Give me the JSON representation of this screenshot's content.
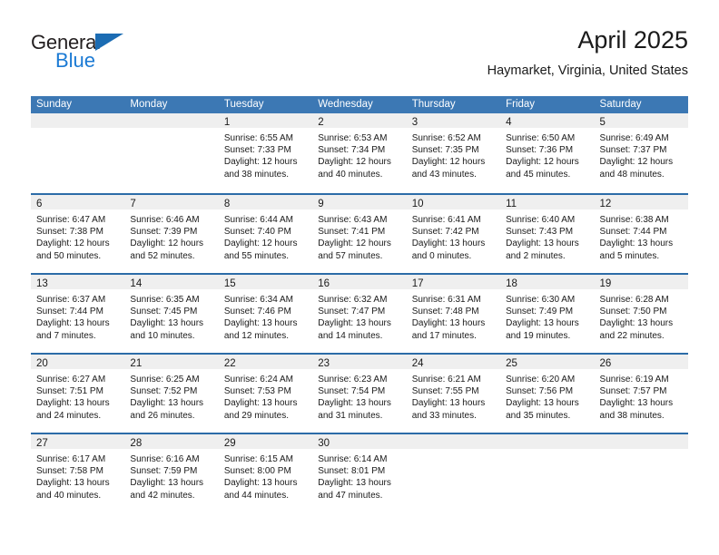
{
  "brand": {
    "name_part1": "General",
    "name_part2": "Blue",
    "accent_color": "#1b7ad4",
    "triangle_color": "#1b6cb3"
  },
  "header": {
    "title": "April 2025",
    "subtitle": "Haymarket, Virginia, United States"
  },
  "calendar": {
    "header_color": "#3c78b4",
    "row_divider_color": "#2c6ca8",
    "daynumber_band_color": "#efefef",
    "weekdays": [
      "Sunday",
      "Monday",
      "Tuesday",
      "Wednesday",
      "Thursday",
      "Friday",
      "Saturday"
    ],
    "weeks": [
      [
        {
          "day": "",
          "sunrise": "",
          "sunset": "",
          "daylight_line1": "",
          "daylight_line2": ""
        },
        {
          "day": "",
          "sunrise": "",
          "sunset": "",
          "daylight_line1": "",
          "daylight_line2": ""
        },
        {
          "day": "1",
          "sunrise": "Sunrise: 6:55 AM",
          "sunset": "Sunset: 7:33 PM",
          "daylight_line1": "Daylight: 12 hours",
          "daylight_line2": "and 38 minutes."
        },
        {
          "day": "2",
          "sunrise": "Sunrise: 6:53 AM",
          "sunset": "Sunset: 7:34 PM",
          "daylight_line1": "Daylight: 12 hours",
          "daylight_line2": "and 40 minutes."
        },
        {
          "day": "3",
          "sunrise": "Sunrise: 6:52 AM",
          "sunset": "Sunset: 7:35 PM",
          "daylight_line1": "Daylight: 12 hours",
          "daylight_line2": "and 43 minutes."
        },
        {
          "day": "4",
          "sunrise": "Sunrise: 6:50 AM",
          "sunset": "Sunset: 7:36 PM",
          "daylight_line1": "Daylight: 12 hours",
          "daylight_line2": "and 45 minutes."
        },
        {
          "day": "5",
          "sunrise": "Sunrise: 6:49 AM",
          "sunset": "Sunset: 7:37 PM",
          "daylight_line1": "Daylight: 12 hours",
          "daylight_line2": "and 48 minutes."
        }
      ],
      [
        {
          "day": "6",
          "sunrise": "Sunrise: 6:47 AM",
          "sunset": "Sunset: 7:38 PM",
          "daylight_line1": "Daylight: 12 hours",
          "daylight_line2": "and 50 minutes."
        },
        {
          "day": "7",
          "sunrise": "Sunrise: 6:46 AM",
          "sunset": "Sunset: 7:39 PM",
          "daylight_line1": "Daylight: 12 hours",
          "daylight_line2": "and 52 minutes."
        },
        {
          "day": "8",
          "sunrise": "Sunrise: 6:44 AM",
          "sunset": "Sunset: 7:40 PM",
          "daylight_line1": "Daylight: 12 hours",
          "daylight_line2": "and 55 minutes."
        },
        {
          "day": "9",
          "sunrise": "Sunrise: 6:43 AM",
          "sunset": "Sunset: 7:41 PM",
          "daylight_line1": "Daylight: 12 hours",
          "daylight_line2": "and 57 minutes."
        },
        {
          "day": "10",
          "sunrise": "Sunrise: 6:41 AM",
          "sunset": "Sunset: 7:42 PM",
          "daylight_line1": "Daylight: 13 hours",
          "daylight_line2": "and 0 minutes."
        },
        {
          "day": "11",
          "sunrise": "Sunrise: 6:40 AM",
          "sunset": "Sunset: 7:43 PM",
          "daylight_line1": "Daylight: 13 hours",
          "daylight_line2": "and 2 minutes."
        },
        {
          "day": "12",
          "sunrise": "Sunrise: 6:38 AM",
          "sunset": "Sunset: 7:44 PM",
          "daylight_line1": "Daylight: 13 hours",
          "daylight_line2": "and 5 minutes."
        }
      ],
      [
        {
          "day": "13",
          "sunrise": "Sunrise: 6:37 AM",
          "sunset": "Sunset: 7:44 PM",
          "daylight_line1": "Daylight: 13 hours",
          "daylight_line2": "and 7 minutes."
        },
        {
          "day": "14",
          "sunrise": "Sunrise: 6:35 AM",
          "sunset": "Sunset: 7:45 PM",
          "daylight_line1": "Daylight: 13 hours",
          "daylight_line2": "and 10 minutes."
        },
        {
          "day": "15",
          "sunrise": "Sunrise: 6:34 AM",
          "sunset": "Sunset: 7:46 PM",
          "daylight_line1": "Daylight: 13 hours",
          "daylight_line2": "and 12 minutes."
        },
        {
          "day": "16",
          "sunrise": "Sunrise: 6:32 AM",
          "sunset": "Sunset: 7:47 PM",
          "daylight_line1": "Daylight: 13 hours",
          "daylight_line2": "and 14 minutes."
        },
        {
          "day": "17",
          "sunrise": "Sunrise: 6:31 AM",
          "sunset": "Sunset: 7:48 PM",
          "daylight_line1": "Daylight: 13 hours",
          "daylight_line2": "and 17 minutes."
        },
        {
          "day": "18",
          "sunrise": "Sunrise: 6:30 AM",
          "sunset": "Sunset: 7:49 PM",
          "daylight_line1": "Daylight: 13 hours",
          "daylight_line2": "and 19 minutes."
        },
        {
          "day": "19",
          "sunrise": "Sunrise: 6:28 AM",
          "sunset": "Sunset: 7:50 PM",
          "daylight_line1": "Daylight: 13 hours",
          "daylight_line2": "and 22 minutes."
        }
      ],
      [
        {
          "day": "20",
          "sunrise": "Sunrise: 6:27 AM",
          "sunset": "Sunset: 7:51 PM",
          "daylight_line1": "Daylight: 13 hours",
          "daylight_line2": "and 24 minutes."
        },
        {
          "day": "21",
          "sunrise": "Sunrise: 6:25 AM",
          "sunset": "Sunset: 7:52 PM",
          "daylight_line1": "Daylight: 13 hours",
          "daylight_line2": "and 26 minutes."
        },
        {
          "day": "22",
          "sunrise": "Sunrise: 6:24 AM",
          "sunset": "Sunset: 7:53 PM",
          "daylight_line1": "Daylight: 13 hours",
          "daylight_line2": "and 29 minutes."
        },
        {
          "day": "23",
          "sunrise": "Sunrise: 6:23 AM",
          "sunset": "Sunset: 7:54 PM",
          "daylight_line1": "Daylight: 13 hours",
          "daylight_line2": "and 31 minutes."
        },
        {
          "day": "24",
          "sunrise": "Sunrise: 6:21 AM",
          "sunset": "Sunset: 7:55 PM",
          "daylight_line1": "Daylight: 13 hours",
          "daylight_line2": "and 33 minutes."
        },
        {
          "day": "25",
          "sunrise": "Sunrise: 6:20 AM",
          "sunset": "Sunset: 7:56 PM",
          "daylight_line1": "Daylight: 13 hours",
          "daylight_line2": "and 35 minutes."
        },
        {
          "day": "26",
          "sunrise": "Sunrise: 6:19 AM",
          "sunset": "Sunset: 7:57 PM",
          "daylight_line1": "Daylight: 13 hours",
          "daylight_line2": "and 38 minutes."
        }
      ],
      [
        {
          "day": "27",
          "sunrise": "Sunrise: 6:17 AM",
          "sunset": "Sunset: 7:58 PM",
          "daylight_line1": "Daylight: 13 hours",
          "daylight_line2": "and 40 minutes."
        },
        {
          "day": "28",
          "sunrise": "Sunrise: 6:16 AM",
          "sunset": "Sunset: 7:59 PM",
          "daylight_line1": "Daylight: 13 hours",
          "daylight_line2": "and 42 minutes."
        },
        {
          "day": "29",
          "sunrise": "Sunrise: 6:15 AM",
          "sunset": "Sunset: 8:00 PM",
          "daylight_line1": "Daylight: 13 hours",
          "daylight_line2": "and 44 minutes."
        },
        {
          "day": "30",
          "sunrise": "Sunrise: 6:14 AM",
          "sunset": "Sunset: 8:01 PM",
          "daylight_line1": "Daylight: 13 hours",
          "daylight_line2": "and 47 minutes."
        },
        {
          "day": "",
          "sunrise": "",
          "sunset": "",
          "daylight_line1": "",
          "daylight_line2": ""
        },
        {
          "day": "",
          "sunrise": "",
          "sunset": "",
          "daylight_line1": "",
          "daylight_line2": ""
        },
        {
          "day": "",
          "sunrise": "",
          "sunset": "",
          "daylight_line1": "",
          "daylight_line2": ""
        }
      ]
    ]
  }
}
